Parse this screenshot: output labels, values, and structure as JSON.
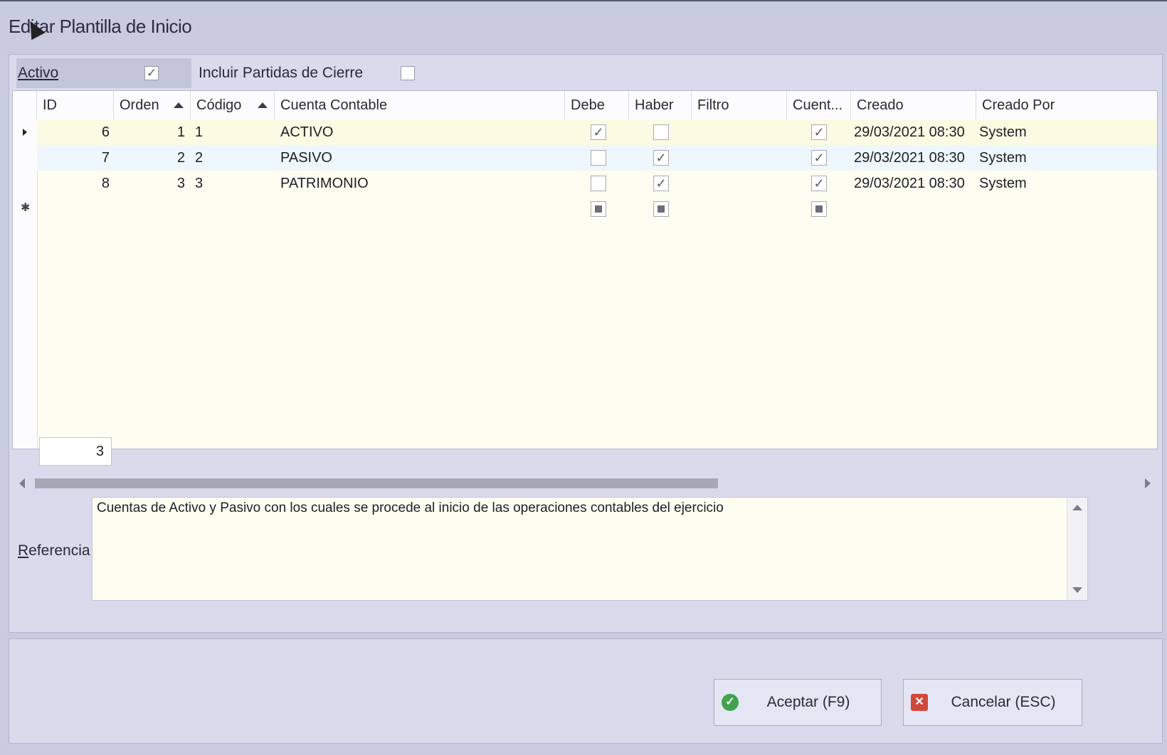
{
  "window": {
    "title": "Editar Plantilla de Inicio"
  },
  "options": {
    "activo_label": "Activo",
    "activo_checked": true,
    "incluir_label": "Incluir Partidas de Cierre",
    "incluir_checked": false
  },
  "grid": {
    "columns": [
      "ID",
      "Orden",
      "Código",
      "Cuenta Contable",
      "Debe",
      "Haber",
      "Filtro",
      "Cuent...",
      "Creado",
      "Creado Por"
    ],
    "rows": [
      {
        "id": "6",
        "orden": "1",
        "codigo": "1",
        "cuenta": "ACTIVO",
        "debe": true,
        "haber": false,
        "filtro": "",
        "cuent": true,
        "creado": "29/03/2021 08:30",
        "creado_por": "System"
      },
      {
        "id": "7",
        "orden": "2",
        "codigo": "2",
        "cuenta": "PASIVO",
        "debe": false,
        "haber": true,
        "filtro": "",
        "cuent": true,
        "creado": "29/03/2021 08:30",
        "creado_por": "System"
      },
      {
        "id": "8",
        "orden": "3",
        "codigo": "3",
        "cuenta": "PATRIMONIO",
        "debe": false,
        "haber": true,
        "filtro": "",
        "cuent": true,
        "creado": "29/03/2021 08:30",
        "creado_por": "System"
      }
    ],
    "row_count": "3"
  },
  "referencia": {
    "label": "Referencia",
    "text": "Cuentas de Activo y Pasivo con los cuales se procede al inicio de las operaciones contables del ejercicio"
  },
  "buttons": {
    "accept": "Aceptar (F9)",
    "cancel": "Cancelar (ESC)"
  },
  "colors": {
    "background": "#c9cbe0",
    "grid_background": "#fefdf1",
    "accept_icon": "#3fa34d",
    "cancel_icon": "#d0483a"
  }
}
